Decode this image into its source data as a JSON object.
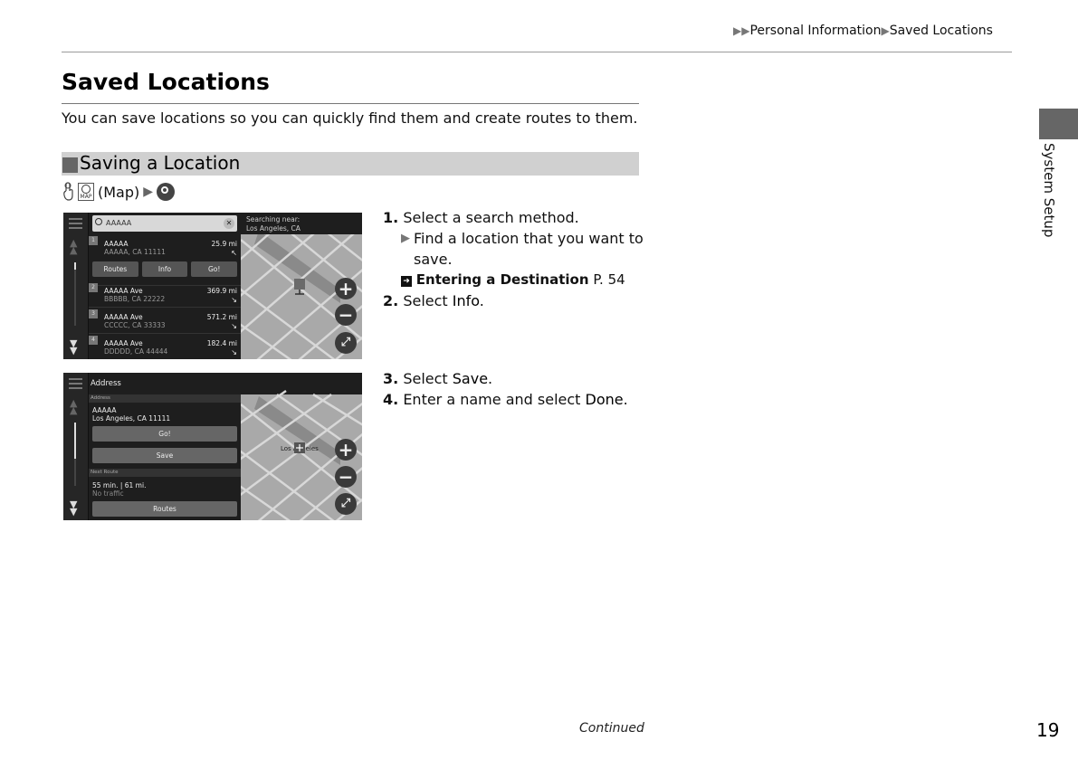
{
  "header": {
    "breadcrumb": [
      "Personal Information",
      "Saved Locations"
    ],
    "breadcrumb_prefix_icon": "double-triangle-right"
  },
  "page": {
    "title": "Saved Locations",
    "intro": "You can save locations so you can quickly find them and create routes to them.",
    "section_title": "Saving a Location",
    "nav_path": {
      "touch_icon": "finger-touch-icon",
      "map_icon_label": "MAP",
      "map_text": "(Map)",
      "search_icon": "search-icon"
    },
    "side_tab": "System Setup",
    "continued": "Continued",
    "page_number": "19"
  },
  "screen1": {
    "search_value": "AAAAA",
    "map_header_line1": "Searching near:",
    "map_header_line2": "Los Angeles, CA",
    "results": [
      {
        "num": "1",
        "name": "AAAAA",
        "addr": "AAAAA, CA 11111",
        "dist": "25.9 mi",
        "arrow": "↖"
      },
      {
        "num": "2",
        "name": "AAAAA Ave",
        "addr": "BBBBB, CA 22222",
        "dist": "369.9 mi",
        "arrow": "↘"
      },
      {
        "num": "3",
        "name": "AAAAA Ave",
        "addr": "CCCCC, CA 33333",
        "dist": "571.2 mi",
        "arrow": "↘"
      },
      {
        "num": "4",
        "name": "AAAAA Ave",
        "addr": "DDDDD, CA 44444",
        "dist": "182.4 mi",
        "arrow": "↘"
      }
    ],
    "buttons": [
      "Routes",
      "Info",
      "Go!"
    ],
    "zoom_in": "+",
    "zoom_out": "−"
  },
  "screen2": {
    "title": "Address",
    "section_address": "Address",
    "name": "AAAAA",
    "addr": "Los Angeles, CA 11111",
    "go_button": "Go!",
    "save_button": "Save",
    "section_route": "Next Route",
    "route_info": "55 min. | 61 mi.",
    "traffic": "No traffic",
    "routes_button": "Routes",
    "map_label": "Los Angeles",
    "zoom_in": "+",
    "zoom_out": "−"
  },
  "steps_a": {
    "s1_num": "1.",
    "s1_text": "Select a search method.",
    "s1_sub": "Find a location that you want to save.",
    "s1_xref_title": "Entering a Destination",
    "s1_xref_page": "P. 54",
    "s2_num": "2.",
    "s2_pre": "Select ",
    "s2_key": "Info",
    "s2_post": "."
  },
  "steps_b": {
    "s3_num": "3.",
    "s3_pre": "Select ",
    "s3_key": "Save",
    "s3_post": ".",
    "s4_num": "4.",
    "s4_pre": "Enter a name and select ",
    "s4_key": "Done",
    "s4_post": "."
  }
}
